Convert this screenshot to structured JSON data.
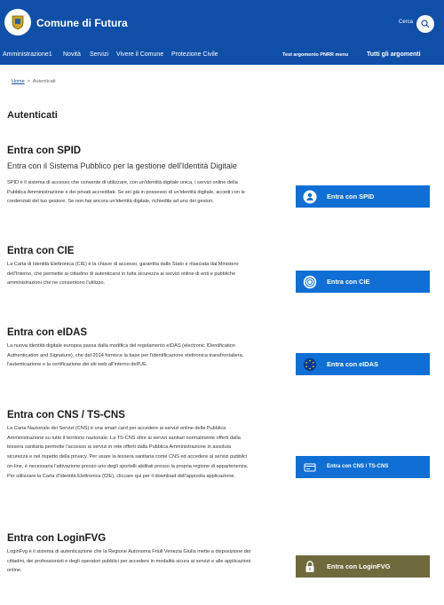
{
  "header": {
    "site_title": "Comune di Futura",
    "search_label": "Cerca",
    "brand_color": "#0f4fa8"
  },
  "nav": {
    "items": [
      "Amministrazione1",
      "Novità",
      "Servizi",
      "Vivere il Comune",
      "Protezione Civile"
    ],
    "right_items": [
      "Test argomento PNRR menu",
      "Tutti gli argomenti"
    ]
  },
  "breadcrumb": {
    "home": "Home",
    "separator": ">",
    "current": "Autenticati"
  },
  "page_title": "Autenticati",
  "sections": [
    {
      "title": "Entra con SPID",
      "subtitle": "Entra con il Sistema Pubblico per la gestione dell'Identità Digitale",
      "description": "SPID è il sistema di accesso che consente di utilizzare, con un'identità digitale unica, i servizi online della Pubblica Amministrazione e dei privati accreditati. Se sei già in possesso di un'identità digitale, accedi con le credenziali del tuo gestore. Se non hai ancora un'identità digitale, richiedila ad uno dei gestori.",
      "button_label": "Entra con SPID",
      "button_icon": "user-circle-icon"
    },
    {
      "title": "Entra con CIE",
      "subtitle": "",
      "description": "La Carta di Identità Elettronica (CIE) è la chiave di accesso, garantita dallo Stato e rilasciata dal Ministero dell'Interno, che permette ai cittadino di autenticarsi in tutta sicurezza ai servizi online di enti e pubbliche amministrazioni che ne consentono l'utilizzo.",
      "button_label": "Entra con CIE",
      "button_icon": "cie-icon"
    },
    {
      "title": "Entra con eIDAS",
      "subtitle": "",
      "description": "La nuova identità digitale europea passa dalla modifica del regolamento eIDAS (electronic IDentification Authentication and Signature), che dal 2014 fornisce la base per l'identificazione elettronica transfrontaliera, l'autenticazione e la certificazione dei siti web all'interno dell'UE.",
      "button_label": "Entra con eIDAS",
      "button_icon": "eu-stars-icon"
    },
    {
      "title": "Entra con CNS / TS-CNS",
      "subtitle": "",
      "description": "La Carta Nazionale dei Servizi (CNS) è una smart card per accedere ai servizi online della Pubblica Amministrazione su tutto il territorio nazionale. La TS-CNS oltre ai servizi sanitari normalmente offerti dalla tessera sanitaria permette l'accesso ai servizi in rete offerti dalla Pubblica Amministrazione in assoluta sicurezza e nel rispetto della privacy. Per usare la tessera sanitaria come CNS ed accedere ai servizi pubblici on-line, è necessaria l'attivazione presso uno degli sportelli abilitati presso la propria regione di appartenenza. Per utilizzare la Carta d'Identità Elettronica (CIE), cliccare qui per il download dell'apposita applicazione.",
      "button_label": "Entra con CNS / TS-CNS",
      "button_icon": "card-icon"
    },
    {
      "title": "Entra con LoginFVG",
      "subtitle": "",
      "description": "LoginFvg è il sistema di autenticazione che la Regione Autonoma Friuli Venezia Giulia mette a disposizione dei cittadini, dei professionisti e degli operatori pubblici per accedere in modalità sicura ai servizi e alle applicazioni online.",
      "button_label": "Entra con LoginFVG",
      "button_icon": "lock-icon"
    }
  ],
  "colors": {
    "button_blue": "#0f6fd4",
    "button_fvg": "#6f6a3c"
  }
}
